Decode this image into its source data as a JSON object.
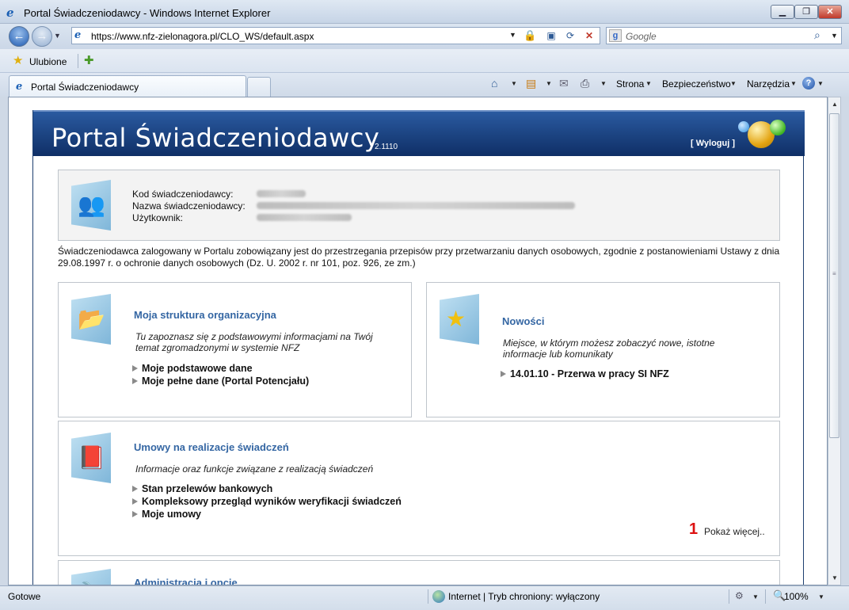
{
  "window": {
    "title": "Portal Świadczeniodawcy - Windows Internet Explorer",
    "min_glyph": "▁",
    "max_glyph": "❐",
    "close_glyph": "✕"
  },
  "address": {
    "url": "https://www.nfz-zielonagora.pl/CLO_WS/default.aspx"
  },
  "search": {
    "placeholder": "Google",
    "engine_glyph": "g"
  },
  "favorites": {
    "label": "Ulubione"
  },
  "tab": {
    "label": "Portal Świadczeniodawcy"
  },
  "command_bar": {
    "page": "Strona",
    "safety": "Bezpieczeństwo",
    "tools": "Narzędzia",
    "help_glyph": "?"
  },
  "portal": {
    "title": "Portal Świadczeniodawcy",
    "version": "2.1110",
    "logout": "[ Wyloguj ]",
    "info": {
      "code_label": "Kod świadczeniodawcy:",
      "name_label": "Nazwa świadczeniodawcy:",
      "user_label": "Użytkownik:"
    },
    "notice": "Świadczeniodawca zalogowany w Portalu zobowiązany jest do przestrzegania przepisów przy przetwarzaniu danych osobowych, zgodnie z postanowieniami Ustawy z dnia 29.08.1997 r. o ochronie danych osobowych (Dz. U. 2002 r. nr 101, poz. 926, ze zm.)",
    "structure": {
      "title": "Moja struktura organizacyjna",
      "desc_line1": "Tu zapoznasz się z podstawowymi informacjami na Twój",
      "desc_line2": "temat zgromadzonymi w systemie NFZ",
      "links": [
        "Moje podstawowe dane",
        "Moje pełne dane (Portal Potencjału)"
      ]
    },
    "news": {
      "title": "Nowości",
      "desc_line1": "Miejsce, w którym możesz zobaczyć nowe, istotne",
      "desc_line2": "informacje lub komunikaty",
      "links": [
        "14.01.10 - Przerwa w pracy SI NFZ"
      ]
    },
    "contracts": {
      "title": "Umowy na realizacje świadczeń",
      "desc": "Informacje oraz funkcje związane z realizacją świadczeń",
      "links": [
        "Stan przelewów bankowych",
        "Kompleksowy przegląd wyników weryfikacji świadczeń",
        "Moje umowy"
      ],
      "more_count": "1",
      "more_label": "Pokaż więcej.."
    },
    "admin": {
      "title": "Administracja i opcje"
    }
  },
  "status": {
    "text": "Gotowe",
    "zone": "Internet | Tryb chroniony: wyłączony",
    "zoom": "100%"
  }
}
